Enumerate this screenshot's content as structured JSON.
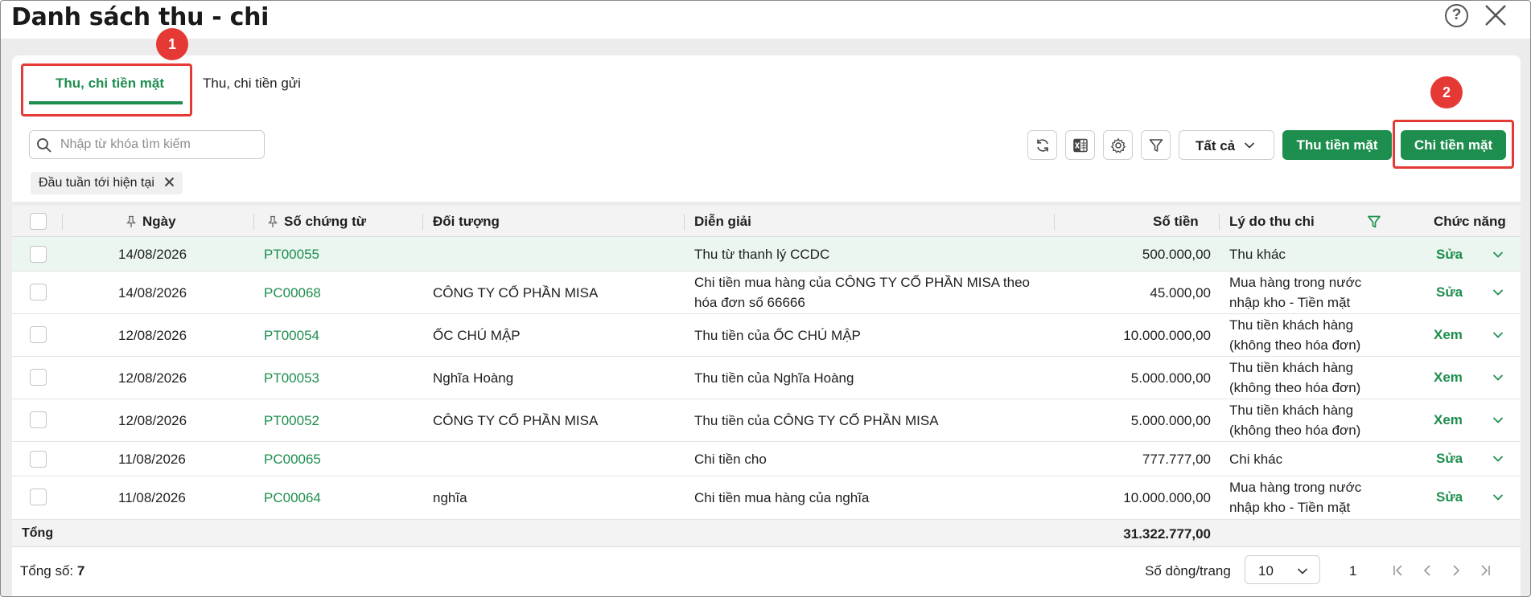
{
  "window": {
    "title": "Danh sách thu - chi"
  },
  "tabs": [
    {
      "label": "Thu, chi tiền mặt",
      "active": true
    },
    {
      "label": "Thu, chi tiền gửi",
      "active": false
    }
  ],
  "markers": [
    "1",
    "2"
  ],
  "toolbar": {
    "search_placeholder": "Nhập từ khóa tìm kiếm",
    "filter_select": "Tất cả",
    "receive_button": "Thu tiền mặt",
    "pay_button": "Chi tiền mặt"
  },
  "filter_chip": "Đầu tuần tới hiện tại",
  "table": {
    "headers": {
      "date": "Ngày",
      "doc_no": "Số chứng từ",
      "party": "Đối tượng",
      "description": "Diễn giải",
      "amount": "Số tiền",
      "reason": "Lý do thu chi",
      "actions": "Chức năng"
    },
    "rows": [
      {
        "date": "14/08/2026",
        "doc_no": "PT00055",
        "party": "",
        "description": "Thu từ thanh lý CCDC",
        "amount": "500.000,00",
        "reason": "Thu khác",
        "action": "Sửa"
      },
      {
        "date": "14/08/2026",
        "doc_no": "PC00068",
        "party": "CÔNG TY CỔ PHẦN MISA",
        "description": "Chi tiền mua hàng của CÔNG TY CỔ PHẦN MISA theo hóa đơn số 66666",
        "amount": "45.000,00",
        "reason": "Mua hàng trong nước nhập kho - Tiền mặt",
        "action": "Sửa"
      },
      {
        "date": "12/08/2026",
        "doc_no": "PT00054",
        "party": "ỐC CHÚ MẬP",
        "description": "Thu tiền của ỐC CHÚ MẬP",
        "amount": "10.000.000,00",
        "reason": "Thu tiền khách hàng (không theo hóa đơn)",
        "action": "Xem"
      },
      {
        "date": "12/08/2026",
        "doc_no": "PT00053",
        "party": "Nghĩa Hoàng",
        "description": "Thu tiền của Nghĩa Hoàng",
        "amount": "5.000.000,00",
        "reason": "Thu tiền khách hàng (không theo hóa đơn)",
        "action": "Xem"
      },
      {
        "date": "12/08/2026",
        "doc_no": "PT00052",
        "party": "CÔNG TY CỔ PHẦN MISA",
        "description": "Thu tiền của CÔNG TY CỔ PHẦN MISA",
        "amount": "5.000.000,00",
        "reason": "Thu tiền khách hàng (không theo hóa đơn)",
        "action": "Xem"
      },
      {
        "date": "11/08/2026",
        "doc_no": "PC00065",
        "party": "",
        "description": "Chi tiền cho",
        "amount": "777.777,00",
        "reason": "Chi khác",
        "action": "Sửa"
      },
      {
        "date": "11/08/2026",
        "doc_no": "PC00064",
        "party": "nghĩa",
        "description": "Chi tiền mua hàng của nghĩa",
        "amount": "10.000.000,00",
        "reason": "Mua hàng trong nước nhập kho - Tiền mặt",
        "action": "Sửa"
      }
    ],
    "total_label": "Tổng",
    "total_amount": "31.322.777,00"
  },
  "footer": {
    "count_label": "Tổng số:",
    "count_value": "7",
    "rows_per_page_label": "Số dòng/trang",
    "rows_per_page": "10",
    "page": "1"
  },
  "colors": {
    "accent": "#1e8e4e",
    "highlight": "#e53935",
    "hover_row": "#eaf6ef"
  }
}
